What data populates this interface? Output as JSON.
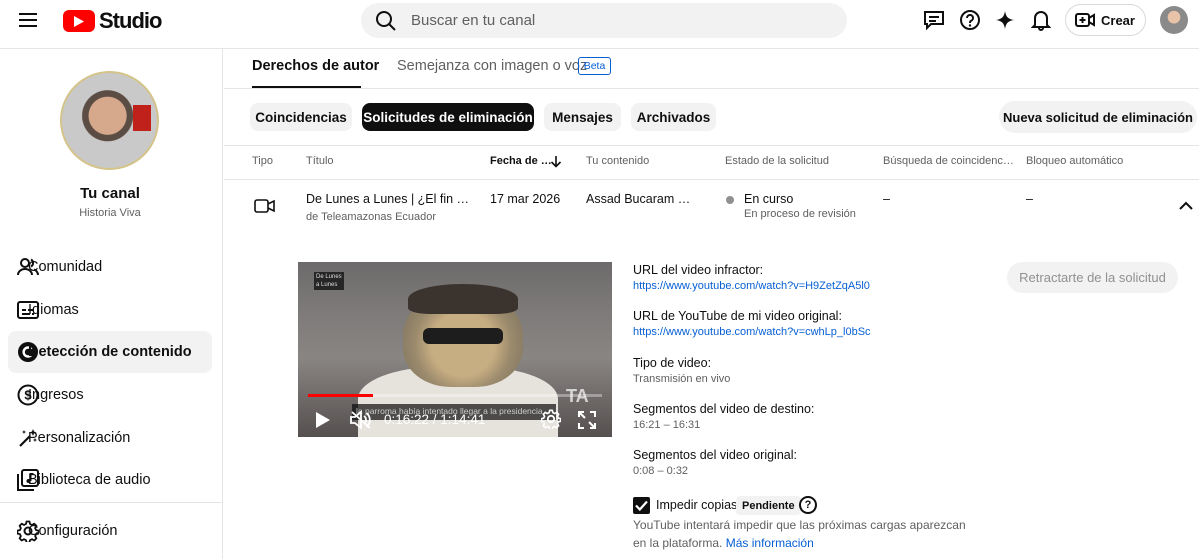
{
  "app": {
    "logo_text": "Studio"
  },
  "search": {
    "placeholder": "Buscar en tu canal"
  },
  "header": {
    "create_label": "Crear"
  },
  "channel": {
    "name": "Tu canal",
    "handle": "Historia Viva"
  },
  "sidebar": {
    "items": [
      {
        "label": "Comunidad",
        "icon": "people-icon"
      },
      {
        "label": "Idiomas",
        "icon": "subtitles-icon"
      },
      {
        "label": "Detección de contenido",
        "icon": "copyright-icon",
        "active": true
      },
      {
        "label": "Ingresos",
        "icon": "dollar-icon"
      },
      {
        "label": "Personalización",
        "icon": "magic-wand-icon"
      },
      {
        "label": "Biblioteca de audio",
        "icon": "audio-library-icon"
      },
      {
        "label": "Configuración",
        "icon": "gear-icon"
      }
    ]
  },
  "tabs": [
    {
      "label": "Derechos de autor",
      "active": true
    },
    {
      "label": "Semejanza con imagen o voz",
      "badge": "Beta"
    }
  ],
  "chips": [
    {
      "label": "Coincidencias"
    },
    {
      "label": "Solicitudes de eliminación",
      "active": true
    },
    {
      "label": "Mensajes"
    },
    {
      "label": "Archivados"
    }
  ],
  "new_request_label": "Nueva solicitud de eliminación",
  "table": {
    "columns": [
      "Tipo",
      "Título",
      "Fecha de …",
      "Tu contenido",
      "Estado de la solicitud",
      "Búsqueda de coincidenc…",
      "Bloqueo automático"
    ],
    "row": {
      "title": "De Lunes a Lunes | ¿El fin …",
      "channel": "de Teleamazonas Ecuador",
      "date": "17 mar 2026",
      "content": "Assad Bucaram …",
      "status": "En curso",
      "status_sub": "En proceso de revisión",
      "match_search": "–",
      "auto_block": "–"
    }
  },
  "player": {
    "time": "0:16:22 / 1:14:41",
    "caption": "la parroma había intentado llegar a la presidencia",
    "corner_logo": "De Lunes a Lunes",
    "watermark": "TA",
    "progress": 0.22
  },
  "details": {
    "infringing_label": "URL del video infractor:",
    "infringing_url": "https://www.youtube.com/watch?v=H9ZetZqA5l0",
    "original_label": "URL de YouTube de mi video original:",
    "original_url": "https://www.youtube.com/watch?v=cwhLp_l0bSc",
    "type_label": "Tipo de video:",
    "type_value": "Transmisión en vivo",
    "target_seg_label": "Segmentos del video de destino:",
    "target_seg_value": "16:21 – 16:31",
    "orig_seg_label": "Segmentos del video original:",
    "orig_seg_value": "0:08 – 0:32",
    "prevent_label": "Impedir copias",
    "prevent_badge": "Pendiente",
    "prevent_desc1": "YouTube intentará impedir que las próximas cargas aparezcan",
    "prevent_desc2": "en la plataforma.",
    "more_info": "Más información",
    "retract_label": "Retractarte de la solicitud"
  },
  "colors": {
    "accent": "#065fd4",
    "brand": "#ff0000"
  }
}
